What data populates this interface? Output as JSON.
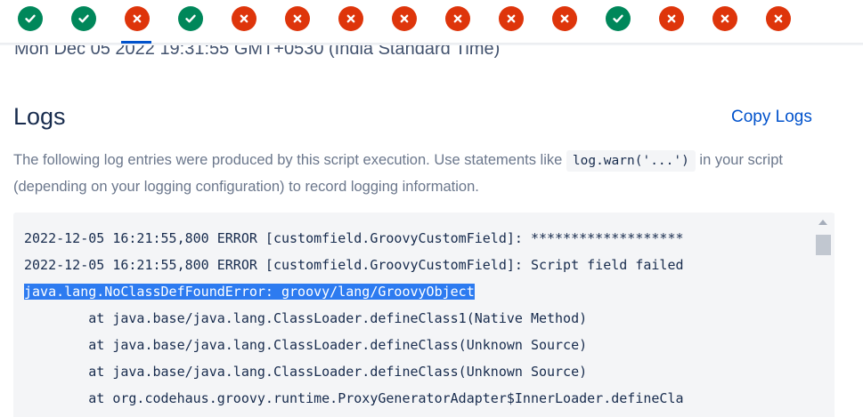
{
  "status_items": [
    {
      "state": "success",
      "icon": "check-icon"
    },
    {
      "state": "success",
      "icon": "check-icon"
    },
    {
      "state": "error",
      "icon": "cross-icon",
      "active": true
    },
    {
      "state": "success",
      "icon": "check-icon"
    },
    {
      "state": "error",
      "icon": "cross-icon"
    },
    {
      "state": "error",
      "icon": "cross-icon"
    },
    {
      "state": "error",
      "icon": "cross-icon"
    },
    {
      "state": "error",
      "icon": "cross-icon"
    },
    {
      "state": "error",
      "icon": "cross-icon"
    },
    {
      "state": "error",
      "icon": "cross-icon"
    },
    {
      "state": "error",
      "icon": "cross-icon"
    },
    {
      "state": "success",
      "icon": "check-icon"
    },
    {
      "state": "error",
      "icon": "cross-icon"
    },
    {
      "state": "error",
      "icon": "cross-icon"
    },
    {
      "state": "error",
      "icon": "cross-icon"
    }
  ],
  "colors": {
    "success": "#00875a",
    "error": "#de350b",
    "accent": "#0052cc",
    "highlight": "#2d7bf0"
  },
  "execution": {
    "timestamp": "Mon Dec 05 2022 19:31:55 GMT+0530 (India Standard Time)"
  },
  "logs": {
    "title": "Logs",
    "copy_label": "Copy Logs",
    "description_before": "The following log entries were produced by this script execution. Use statements like ",
    "code_example": "log.warn('...')",
    "description_after": " in your script (depending on your logging configuration) to record logging information.",
    "lines": [
      "2022-12-05 16:21:55,800 ERROR [customfield.GroovyCustomField]: *******************",
      "2022-12-05 16:21:55,800 ERROR [customfield.GroovyCustomField]: Script field failed",
      "java.lang.NoClassDefFoundError: groovy/lang/GroovyObject",
      "        at java.base/java.lang.ClassLoader.defineClass1(Native Method)",
      "        at java.base/java.lang.ClassLoader.defineClass(Unknown Source)",
      "        at java.base/java.lang.ClassLoader.defineClass(Unknown Source)",
      "        at org.codehaus.groovy.runtime.ProxyGeneratorAdapter$InnerLoader.defineCla"
    ],
    "selected_line": 2
  }
}
